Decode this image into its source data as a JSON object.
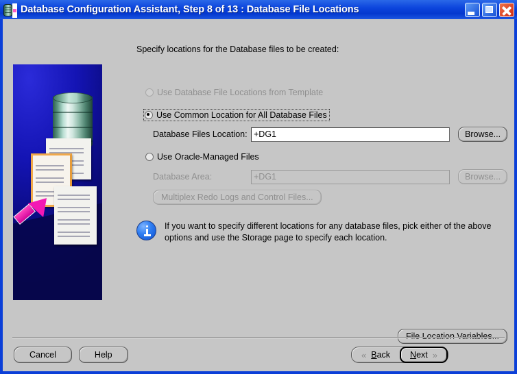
{
  "window": {
    "title": "Database Configuration Assistant, Step 8 of 13 : Database File Locations",
    "icon": "database-app-icon",
    "controls": {
      "minimize": "minimize-icon",
      "maximize": "maximize-icon",
      "close": "close-icon"
    }
  },
  "sidebar": {
    "artwork": "database-documents-illustration"
  },
  "main": {
    "intro": "Specify locations for the Database files to be created:",
    "options": [
      {
        "id": "template",
        "label": "Use Database File Locations from Template",
        "selected": false,
        "enabled": false,
        "focused": false
      },
      {
        "id": "common",
        "label": "Use Common Location for All Database Files",
        "selected": true,
        "enabled": true,
        "focused": true
      },
      {
        "id": "omf",
        "label": "Use Oracle-Managed Files",
        "selected": false,
        "enabled": true,
        "focused": false
      }
    ],
    "fields": [
      {
        "id": "db-files-location",
        "label": "Database Files Location:",
        "value": "+DG1",
        "enabled": true,
        "browse_label": "Browse..."
      },
      {
        "id": "db-area",
        "label": "Database Area:",
        "value": "+DG1",
        "enabled": false,
        "browse_label": "Browse..."
      }
    ],
    "multiplex_label": "Multiplex Redo Logs and Control Files...",
    "note": "If you want to specify different locations for any database files, pick either of the above options and use the Storage page to specify each location."
  },
  "footer": {
    "file_location_variables_label": "File Location Variables...",
    "cancel_label": "Cancel",
    "help_label": "Help",
    "back": {
      "label": "Back",
      "mnemonic": "B",
      "rest": "ack",
      "icon": "chevron-left-double-icon"
    },
    "next": {
      "label": "Next",
      "mnemonic": "N",
      "rest": "ext",
      "icon": "chevron-right-double-icon"
    }
  },
  "colors": {
    "window_border": "#0b3fd8",
    "panel": "#c6c6c6",
    "titlebar": "#0d46dd",
    "info_blue": "#2f7ef2",
    "art_blue": "#1414b4",
    "arrow_pink": "#f318b4"
  }
}
